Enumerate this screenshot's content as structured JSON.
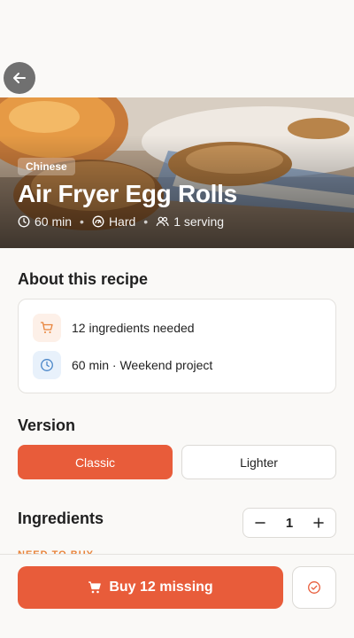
{
  "recipe": {
    "cuisine": "Chinese",
    "title": "Air Fryer Egg Rolls",
    "time": "60 min",
    "difficulty": "Hard",
    "servings": "1 serving"
  },
  "about": {
    "title": "About this recipe",
    "ingredients_needed": "12 ingredients needed",
    "time_note": "60 min · Weekend project"
  },
  "version": {
    "title": "Version",
    "options": [
      "Classic",
      "Lighter"
    ],
    "selected": "Classic"
  },
  "ingredients": {
    "title": "Ingredients",
    "servings_count": "1",
    "need_to_buy_label": "NEED TO BUY"
  },
  "actions": {
    "buy_label": "Buy 12 missing"
  },
  "colors": {
    "accent": "#e85c3a",
    "accent_light": "#fdf0e8",
    "blue_icon": "#4a86c8"
  },
  "icons": {
    "back": "arrow-left-icon",
    "clock": "clock-icon",
    "difficulty": "gauge-icon",
    "servings": "users-icon",
    "cart": "cart-icon",
    "minus": "minus-icon",
    "plus": "plus-icon",
    "check": "check-circle-icon"
  }
}
